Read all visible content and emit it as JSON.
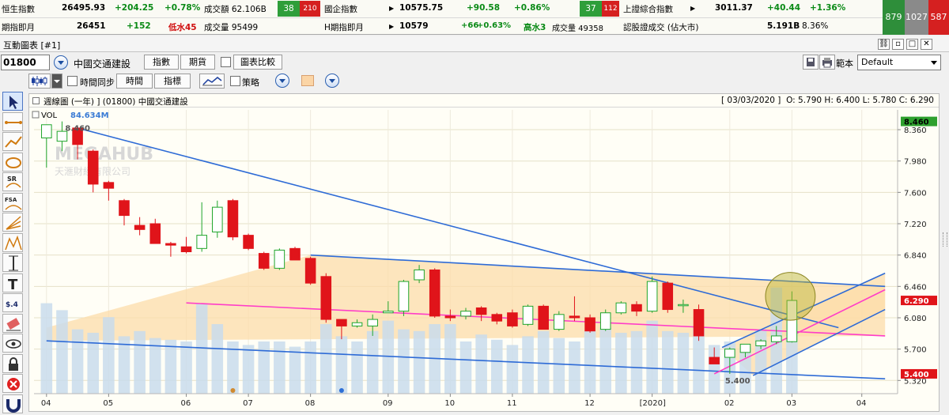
{
  "ticker": {
    "row1": {
      "hsi": {
        "label": "恒生指數",
        "value": "26495.93",
        "change": "+204.25",
        "pct": "+0.78%",
        "turnover": "成交額 62.106B",
        "up": "38",
        "down": "210"
      },
      "hscei": {
        "label": "國企指數",
        "value": "10575.75",
        "change": "+90.58",
        "pct": "+0.86%",
        "up": "37",
        "down": "112"
      },
      "sse": {
        "label": "上證綜合指數",
        "value": "3011.37",
        "change": "+40.44",
        "pct": "+1.36%"
      }
    },
    "row2": {
      "hsi_fut": {
        "label": "期指即月",
        "value": "26451",
        "change": "+152",
        "discount": "低水45",
        "volume": "成交量 95499"
      },
      "hhi_fut": {
        "label": "H期指即月",
        "value": "10579",
        "change": "+66",
        "pct": "+0.63%",
        "premium": "高水3",
        "volume": "成交量 49358"
      },
      "warrant": {
        "label": "認股證成交 (佔大市)",
        "value": "5.191B",
        "pct": "8.36%"
      }
    },
    "market_breadth": {
      "up": "879",
      "flat": "1027",
      "down": "587"
    }
  },
  "window": {
    "title": "互動圖表 [#1]",
    "icons": [
      "link-icon",
      "restore-icon",
      "maximize-icon",
      "close-icon"
    ]
  },
  "toolbar1": {
    "stock_code": "01800",
    "stock_name": "中國交通建設",
    "btn_index": "指數",
    "btn_futures": "期貨",
    "compare_label": "圖表比較",
    "template_label": "範本",
    "template_value": "Default"
  },
  "toolbar2": {
    "time_sync_label": "時間同步",
    "btn_time": "時間",
    "btn_indicator": "指標",
    "strategy_label": "策略"
  },
  "left_tools": [
    "cursor-tool-icon",
    "line-tool-icon",
    "trend-tool-icon",
    "ellipse-tool-icon",
    "sr-tool-icon",
    "fsa-tool-icon",
    "fan-tool-icon",
    "wave-tool-icon",
    "measure-tool-icon",
    "text-tool-icon",
    "price-tool-icon",
    "eraser-tool-icon",
    "eye-tool-icon",
    "lock-tool-icon",
    "delete-tool-icon",
    "magnet-tool-icon"
  ],
  "chart_header": {
    "title": "週線圖 (一年) ] (01800)  中國交通建設",
    "date": "[ 03/03/2020 ]",
    "ohlc": "O: 5.790  H: 6.400  L: 5.780  C: 6.290"
  },
  "vol_label": "VOL",
  "vol_value": "84.634M",
  "watermark": "MEGAHUB",
  "watermark_sub": "天滙財經有限公司",
  "colors": {
    "up": "#1fa52b",
    "down": "#e0141a",
    "trendline": "#2e6bd6",
    "midline": "#ff3cc8",
    "volume": "#c9dcec",
    "fill": "#fcdcaa",
    "highlight_circle": "#b8b22a"
  },
  "chart_data": {
    "type": "candlestick",
    "ylim": [
      5.16,
      8.6
    ],
    "yticks": [
      "8.360",
      "7.980",
      "7.600",
      "7.220",
      "6.840",
      "6.460",
      "6.080",
      "5.700",
      "5.320"
    ],
    "xticks": [
      "04",
      "05",
      "06",
      "07",
      "08",
      "09",
      "10",
      "11",
      "12",
      "[2020]",
      "02",
      "03",
      "04"
    ],
    "price_tags": [
      {
        "label": "8.460",
        "value": 8.46,
        "color": "#2ea02e"
      },
      {
        "label": "6.290",
        "value": 6.29,
        "color": "#e0141a"
      },
      {
        "label": "5.400",
        "value": 5.4,
        "color": "#e0141a"
      }
    ],
    "annotations": [
      {
        "label": "8.460",
        "value": 8.46
      },
      {
        "label": "5.400",
        "value": 5.4
      }
    ],
    "candles": [
      {
        "o": 8.26,
        "h": 8.4,
        "l": 7.9,
        "c": 8.42,
        "d": 0
      },
      {
        "o": 8.22,
        "h": 8.46,
        "l": 8.1,
        "c": 8.34,
        "d": 1
      },
      {
        "o": 8.38,
        "h": 8.4,
        "l": 8.0,
        "c": 8.18,
        "d": 0
      },
      {
        "o": 8.1,
        "h": 8.12,
        "l": 7.6,
        "c": 7.7,
        "d": 0
      },
      {
        "o": 7.72,
        "h": 7.74,
        "l": 7.5,
        "c": 7.65,
        "d": 0
      },
      {
        "o": 7.5,
        "h": 7.52,
        "l": 7.2,
        "c": 7.32,
        "d": 0
      },
      {
        "o": 7.2,
        "h": 7.3,
        "l": 7.08,
        "c": 7.15,
        "d": 0
      },
      {
        "o": 7.22,
        "h": 7.28,
        "l": 6.98,
        "c": 6.98,
        "d": 0
      },
      {
        "o": 6.98,
        "h": 7.0,
        "l": 6.82,
        "c": 6.96,
        "d": 0
      },
      {
        "o": 6.94,
        "h": 7.06,
        "l": 6.86,
        "c": 6.88,
        "d": 0
      },
      {
        "o": 6.92,
        "h": 7.48,
        "l": 6.88,
        "c": 7.08,
        "d": 1
      },
      {
        "o": 7.12,
        "h": 7.5,
        "l": 7.05,
        "c": 7.42,
        "d": 1
      },
      {
        "o": 7.5,
        "h": 7.52,
        "l": 7.02,
        "c": 7.06,
        "d": 0
      },
      {
        "o": 7.08,
        "h": 7.1,
        "l": 6.9,
        "c": 6.92,
        "d": 0
      },
      {
        "o": 6.86,
        "h": 6.88,
        "l": 6.66,
        "c": 6.68,
        "d": 0
      },
      {
        "o": 6.68,
        "h": 6.92,
        "l": 6.66,
        "c": 6.9,
        "d": 1
      },
      {
        "o": 6.92,
        "h": 6.94,
        "l": 6.78,
        "c": 6.78,
        "d": 0
      },
      {
        "o": 6.8,
        "h": 6.82,
        "l": 6.48,
        "c": 6.5,
        "d": 0
      },
      {
        "o": 6.58,
        "h": 6.62,
        "l": 6.02,
        "c": 6.06,
        "d": 0
      },
      {
        "o": 6.06,
        "h": 6.06,
        "l": 5.82,
        "c": 5.98,
        "d": 0
      },
      {
        "o": 5.98,
        "h": 6.06,
        "l": 5.96,
        "c": 6.02,
        "d": 1
      },
      {
        "o": 5.98,
        "h": 6.12,
        "l": 5.86,
        "c": 6.06,
        "d": 1
      },
      {
        "o": 6.14,
        "h": 6.28,
        "l": 6.14,
        "c": 6.16,
        "d": 1
      },
      {
        "o": 6.16,
        "h": 6.54,
        "l": 6.1,
        "c": 6.52,
        "d": 1
      },
      {
        "o": 6.54,
        "h": 6.72,
        "l": 6.5,
        "c": 6.66,
        "d": 1
      },
      {
        "o": 6.66,
        "h": 6.68,
        "l": 6.08,
        "c": 6.1,
        "d": 0
      },
      {
        "o": 6.1,
        "h": 6.18,
        "l": 6.04,
        "c": 6.08,
        "d": 0
      },
      {
        "o": 6.1,
        "h": 6.2,
        "l": 6.06,
        "c": 6.16,
        "d": 1
      },
      {
        "o": 6.2,
        "h": 6.22,
        "l": 6.04,
        "c": 6.12,
        "d": 0
      },
      {
        "o": 6.12,
        "h": 6.14,
        "l": 6.0,
        "c": 6.04,
        "d": 0
      },
      {
        "o": 6.14,
        "h": 6.18,
        "l": 5.96,
        "c": 5.98,
        "d": 0
      },
      {
        "o": 6.0,
        "h": 6.24,
        "l": 5.98,
        "c": 6.22,
        "d": 1
      },
      {
        "o": 6.22,
        "h": 6.24,
        "l": 5.94,
        "c": 5.94,
        "d": 0
      },
      {
        "o": 5.94,
        "h": 6.16,
        "l": 5.92,
        "c": 6.12,
        "d": 1
      },
      {
        "o": 6.1,
        "h": 6.34,
        "l": 6.04,
        "c": 6.08,
        "d": 0
      },
      {
        "o": 6.08,
        "h": 6.12,
        "l": 5.9,
        "c": 5.92,
        "d": 0
      },
      {
        "o": 5.94,
        "h": 6.18,
        "l": 5.92,
        "c": 6.14,
        "d": 1
      },
      {
        "o": 6.14,
        "h": 6.28,
        "l": 6.12,
        "c": 6.26,
        "d": 1
      },
      {
        "o": 6.24,
        "h": 6.28,
        "l": 6.1,
        "c": 6.16,
        "d": 0
      },
      {
        "o": 6.16,
        "h": 6.58,
        "l": 6.14,
        "c": 6.52,
        "d": 1
      },
      {
        "o": 6.5,
        "h": 6.52,
        "l": 6.14,
        "c": 6.18,
        "d": 0
      },
      {
        "o": 6.24,
        "h": 6.3,
        "l": 6.14,
        "c": 6.24,
        "d": 1
      },
      {
        "o": 6.18,
        "h": 6.24,
        "l": 5.8,
        "c": 5.86,
        "d": 0
      },
      {
        "o": 5.6,
        "h": 5.72,
        "l": 5.52,
        "c": 5.52,
        "d": 0
      },
      {
        "o": 5.6,
        "h": 5.72,
        "l": 5.4,
        "c": 5.7,
        "d": 1
      },
      {
        "o": 5.66,
        "h": 5.76,
        "l": 5.6,
        "c": 5.76,
        "d": 1
      },
      {
        "o": 5.74,
        "h": 5.82,
        "l": 5.7,
        "c": 5.8,
        "d": 1
      },
      {
        "o": 5.79,
        "h": 5.98,
        "l": 5.76,
        "c": 5.86,
        "d": 1
      },
      {
        "o": 5.79,
        "h": 6.4,
        "l": 5.78,
        "c": 6.29,
        "d": 1
      }
    ],
    "volume_rel": [
      0.52,
      0.48,
      0.37,
      0.35,
      0.44,
      0.33,
      0.36,
      0.32,
      0.31,
      0.3,
      0.52,
      0.4,
      0.3,
      0.28,
      0.3,
      0.3,
      0.27,
      0.3,
      0.4,
      0.33,
      0.3,
      0.36,
      0.42,
      0.37,
      0.36,
      0.4,
      0.4,
      0.3,
      0.34,
      0.31,
      0.28,
      0.33,
      0.36,
      0.32,
      0.3,
      0.36,
      0.38,
      0.35,
      0.36,
      0.42,
      0.36,
      0.35,
      0.38,
      0.28,
      0.3,
      0.27,
      0.37,
      0.61,
      0.4
    ],
    "lines": [
      {
        "name": "upper-downtrend",
        "x1": 2.5,
        "y1": 8.38,
        "x2": 51.5,
        "y2": 5.96,
        "color": "#2e6bd6"
      },
      {
        "name": "channel-top",
        "x1": 17.5,
        "y1": 6.84,
        "x2": 54.5,
        "y2": 6.46,
        "color": "#2e6bd6"
      },
      {
        "name": "lower-bound",
        "x1": 0.5,
        "y1": 5.8,
        "x2": 54.5,
        "y2": 5.34,
        "color": "#2e6bd6"
      },
      {
        "name": "mid-pink",
        "x1": 9.5,
        "y1": 6.26,
        "x2": 54.5,
        "y2": 5.86,
        "color": "#ff3cc8"
      },
      {
        "name": "up-ch-1",
        "x1": 44.0,
        "y1": 5.72,
        "x2": 54.5,
        "y2": 6.62,
        "color": "#2e6bd6"
      },
      {
        "name": "up-ch-2",
        "x1": 46.0,
        "y1": 5.38,
        "x2": 54.5,
        "y2": 6.18,
        "color": "#2e6bd6"
      },
      {
        "name": "up-pink",
        "x1": 43.5,
        "y1": 5.4,
        "x2": 54.5,
        "y2": 6.42,
        "color": "#ff3cc8"
      }
    ],
    "fill_polygon": [
      [
        0.5,
        5.96
      ],
      [
        17.5,
        6.84
      ],
      [
        54.5,
        6.46
      ],
      [
        54.5,
        5.86
      ],
      [
        0.5,
        5.8
      ]
    ],
    "highlight": {
      "x": 48.4,
      "y": 6.34,
      "rx": 1.6,
      "ry": 0.29
    },
    "event_dots": [
      {
        "x": 12.5,
        "color": "#d08a30"
      },
      {
        "x": 19.5,
        "color": "#2d6fd6"
      }
    ]
  }
}
